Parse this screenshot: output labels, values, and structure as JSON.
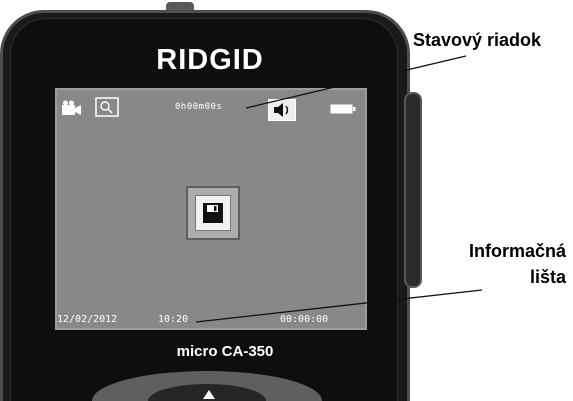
{
  "callouts": {
    "status_bar_label": "Stavový riadok",
    "info_bar_label_line1": "Informačná",
    "info_bar_label_line2": "lišta"
  },
  "device": {
    "brand_logo": "RIDGID",
    "model": "micro CA-350",
    "body_color": "#1a1a1a",
    "screen_color": "#888888"
  },
  "screen": {
    "status_bar": {
      "icons": [
        "camcorder-icon",
        "zoom-icon",
        "speaker-icon",
        "battery-icon"
      ],
      "recording_time": "0h00m00s"
    },
    "center_icon": "save-icon",
    "info_bar": {
      "date": "12/02/2012",
      "time": "10:20",
      "elapsed": "00:00:00"
    }
  }
}
